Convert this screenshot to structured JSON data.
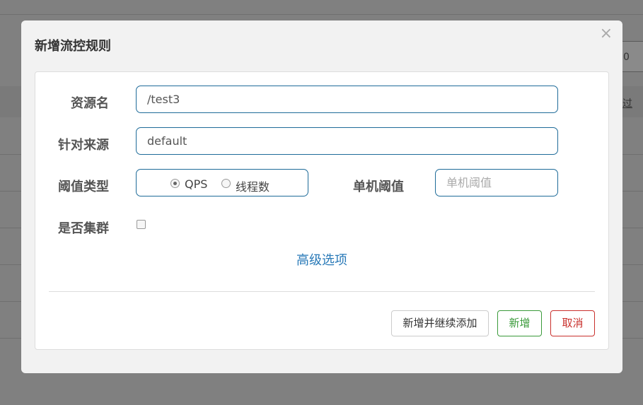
{
  "background": {
    "input_value": "0",
    "side_text": "过"
  },
  "modal": {
    "title": "新增流控规则",
    "close_glyph": "×",
    "form": {
      "resource_name": {
        "label": "资源名",
        "value": "/test3"
      },
      "limit_app": {
        "label": "针对来源",
        "value": "default"
      },
      "grade": {
        "label": "阈值类型",
        "options": [
          {
            "label": "QPS",
            "checked": true
          },
          {
            "label": "线程数",
            "checked": false
          }
        ]
      },
      "count": {
        "label": "单机阈值",
        "value": "",
        "placeholder": "单机阈值"
      },
      "cluster": {
        "label": "是否集群",
        "checked": false
      },
      "advanced_link": "高级选项"
    },
    "buttons": {
      "add_continue": "新增并继续添加",
      "add": "新增",
      "cancel": "取消"
    }
  },
  "colors": {
    "input_border": "#1e6b99",
    "link": "#2a7ab8",
    "success": "#3a9a3a",
    "danger": "#c9302c"
  }
}
